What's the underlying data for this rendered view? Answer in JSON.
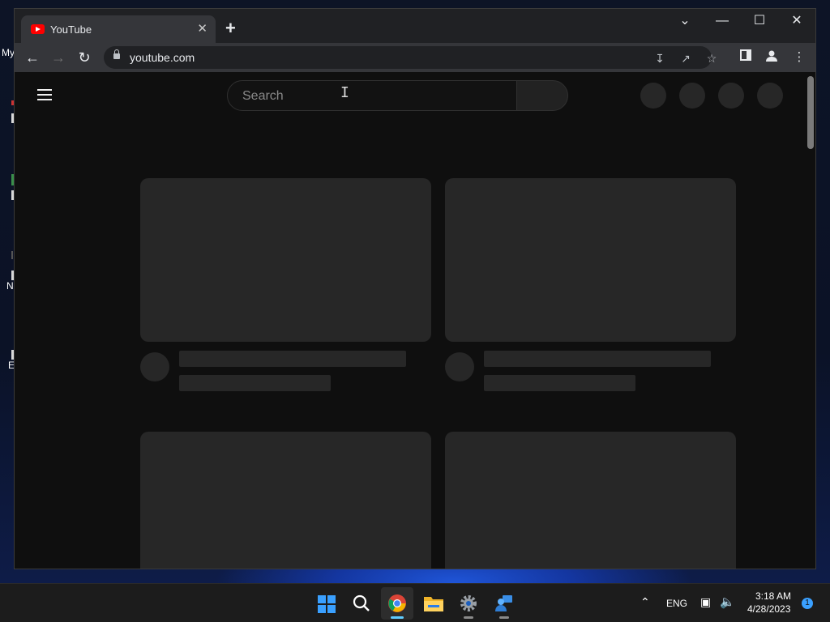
{
  "desktop": {
    "icon_labels": [
      "My",
      "N",
      "E"
    ]
  },
  "browser": {
    "tab": {
      "title": "YouTube",
      "favicon": "youtube-icon"
    },
    "new_tab_label": "+",
    "address": {
      "url": "youtube.com"
    },
    "window_controls": {
      "tab_search": "⌄",
      "minimize": "—",
      "maximize": "☐",
      "close": "✕"
    }
  },
  "youtube": {
    "search": {
      "placeholder": "Search",
      "value": ""
    },
    "state": "loading-skeleton"
  },
  "taskbar": {
    "apps": [
      "start",
      "search",
      "chrome",
      "file-explorer",
      "settings",
      "remote-assistance"
    ],
    "active_app": "chrome",
    "language": "ENG",
    "time": "3:18 AM",
    "date": "4/28/2023",
    "notification_count": "1"
  },
  "colors": {
    "page_bg": "#0f0f0f",
    "skeleton": "#272727",
    "tab_active": "#35363a",
    "tab_strip": "#202124",
    "accent": "#60cdff"
  }
}
